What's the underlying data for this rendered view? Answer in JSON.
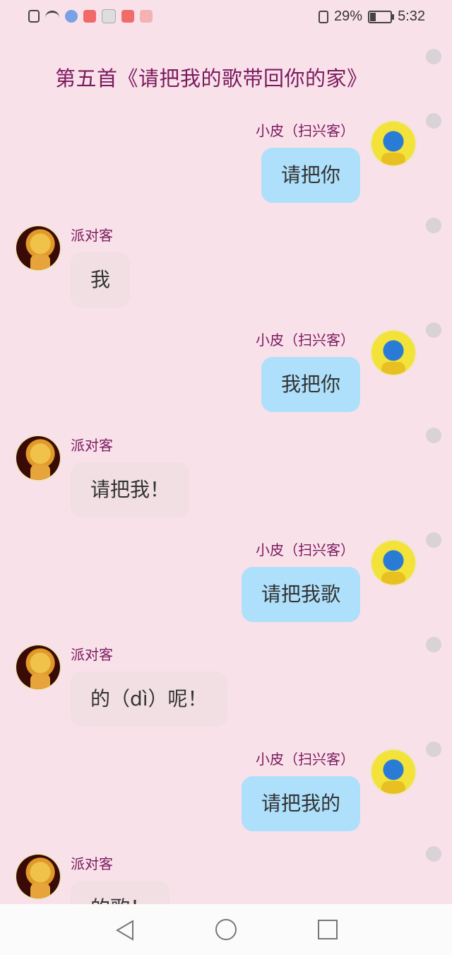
{
  "status_bar": {
    "battery": "29%",
    "battery_level": 0.29,
    "time": "5:32"
  },
  "title": "第五首《请把我的歌带回你的家》",
  "messages": [
    {
      "side": "right",
      "name": "小皮（扫兴客）",
      "text": "请把你",
      "avatar": "yellow-robot-avatar"
    },
    {
      "side": "left",
      "name": "派对客",
      "text": "我",
      "avatar": "dark-figure-avatar"
    },
    {
      "side": "right",
      "name": "小皮（扫兴客）",
      "text": "我把你",
      "avatar": "yellow-robot-avatar"
    },
    {
      "side": "left",
      "name": "派对客",
      "text": "请把我！",
      "avatar": "dark-figure-avatar"
    },
    {
      "side": "right",
      "name": "小皮（扫兴客）",
      "text": "请把我歌",
      "avatar": "yellow-robot-avatar"
    },
    {
      "side": "left",
      "name": "派对客",
      "text": "的（dì）呢！",
      "avatar": "dark-figure-avatar"
    },
    {
      "side": "right",
      "name": "小皮（扫兴客）",
      "text": "请把我的",
      "avatar": "yellow-robot-avatar"
    },
    {
      "side": "left",
      "name": "派对客",
      "text": "的歌！",
      "avatar": "dark-figure-avatar"
    }
  ],
  "colors": {
    "background": "#f9e1ea",
    "right_bubble": "#aee0fb",
    "left_bubble": "#f1dfe3",
    "name_text": "#7b1a5e"
  },
  "navigation": {
    "icons": [
      "back-triangle-icon",
      "home-circle-icon",
      "recents-square-icon"
    ]
  }
}
